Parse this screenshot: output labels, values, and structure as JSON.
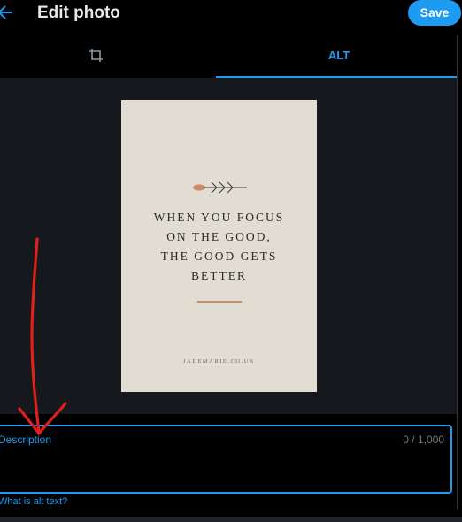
{
  "header": {
    "title": "Edit photo",
    "save_label": "Save",
    "back_icon": "arrow-left-icon"
  },
  "tabs": {
    "crop_icon": "crop-icon",
    "alt_label": "ALT"
  },
  "photo": {
    "quote_lines": [
      "WHEN YOU FOCUS",
      "ON THE GOOD,",
      "THE GOOD GETS",
      "BETTER"
    ],
    "website": "JADEMARIE.CO.UK"
  },
  "description": {
    "label": "Description",
    "counter": "0 / 1,000"
  },
  "help": {
    "alt_link": "What is alt text?"
  },
  "colors": {
    "accent": "#1d9bf0",
    "background": "#000000",
    "media_background": "#15181c",
    "photo_background": "#e2ddd3",
    "annotation": "#e0201a"
  }
}
